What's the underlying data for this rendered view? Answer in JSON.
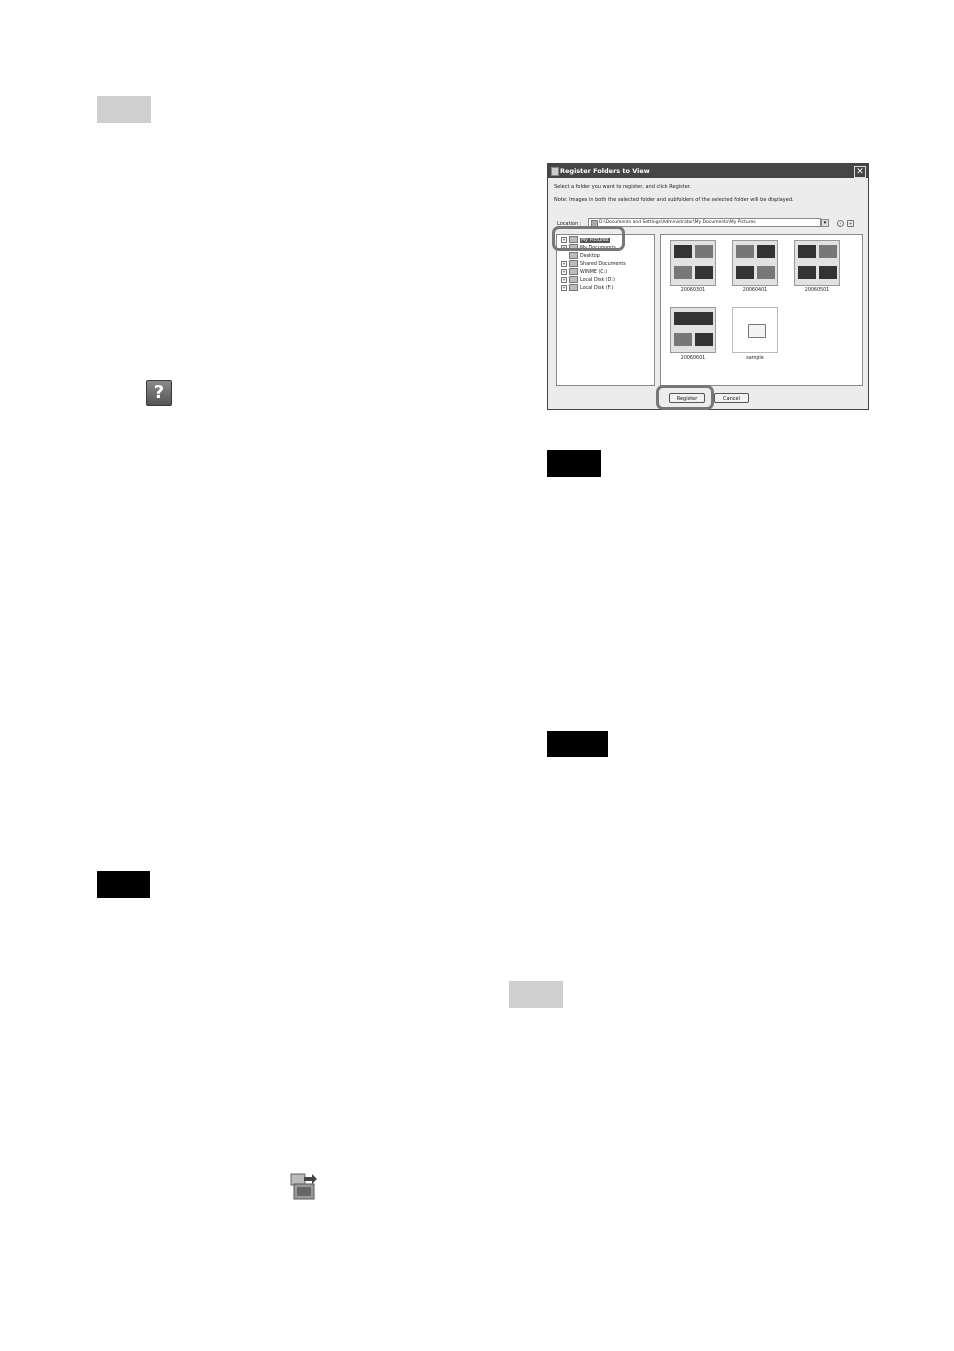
{
  "dialog": {
    "title": "Register Folders to View",
    "close_glyph": "✕",
    "instruction": "Select a folder you want to register, and click Register.",
    "note": "Note: Images in both the selected folder and subfolders of the selected folder will be displayed.",
    "location_label": "Location :",
    "location_value": "D:\\Documents and Settings\\Administrator\\My Documents\\My Pictures",
    "tree": [
      {
        "label": "My Pictures",
        "expander": "+"
      },
      {
        "label": "My Documents",
        "expander": "+"
      },
      {
        "label": "Desktop",
        "expander": ""
      },
      {
        "label": "Shared Documents",
        "expander": "+"
      },
      {
        "label": "WINME (C:)",
        "expander": "+"
      },
      {
        "label": "Local Disk (D:)",
        "expander": "+"
      },
      {
        "label": "Local Disk (F:)",
        "expander": "+"
      }
    ],
    "folders": [
      "20060301",
      "20060401",
      "20060501",
      "20060601",
      "sample"
    ],
    "register_label": "Register",
    "cancel_label": "Cancel"
  },
  "icons": {
    "help": "help-icon",
    "help_glyph": "?",
    "import": "import-folder-icon"
  }
}
